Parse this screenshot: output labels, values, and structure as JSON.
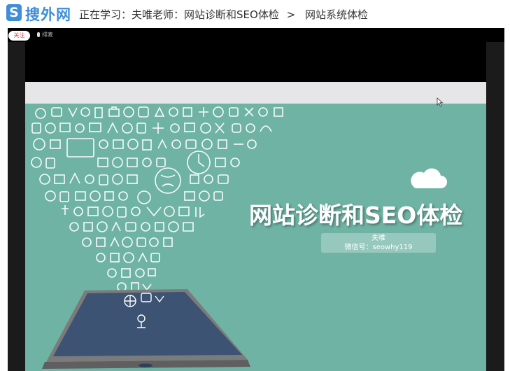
{
  "header": {
    "logo_letter": "S",
    "logo_text": "搜外网",
    "breadcrumb": {
      "prefix": "正在学习：",
      "course": "夫唯老师：网站诊断和SEO体检",
      "separator": ">",
      "lesson": "网站系统体检"
    }
  },
  "player": {
    "follow_label": "关注",
    "mic_label": "排麦"
  },
  "slide": {
    "title": "网站诊断和SEO体检",
    "author": "夫唯",
    "wechat": "微信号：seowhy119"
  },
  "colors": {
    "brand_blue": "#3f8ed8",
    "slide_teal": "#6fb3a4",
    "tablet_screen": "#3d5373",
    "follow_red": "#e2434b"
  }
}
